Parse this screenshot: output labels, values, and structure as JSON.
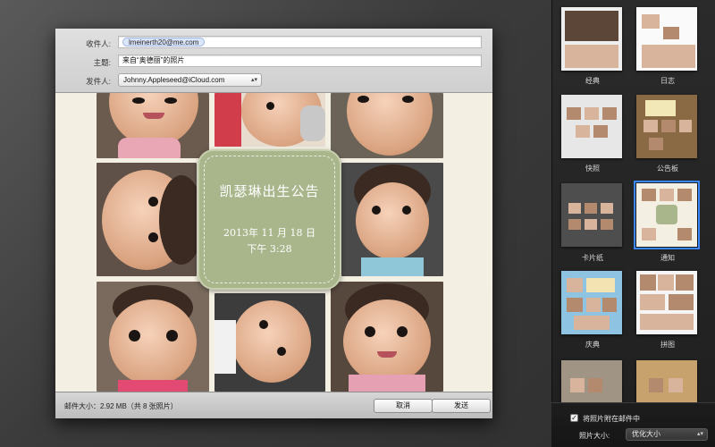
{
  "compose": {
    "to_label": "收件人:",
    "to_value": "lmeinerth20@me.com",
    "subject_label": "主题:",
    "subject_value": "来自“奥德丽”的照片",
    "from_label": "发件人:",
    "from_value": "Johnny.Appleseed@iCloud.com"
  },
  "card": {
    "title": "凯瑟琳出生公告",
    "date": "2013年 11 月 18 日",
    "time": "下午 3:28"
  },
  "footer": {
    "size_text": "邮件大小：2.92 MB（共 8 张照片）",
    "cancel_label": "取消",
    "send_label": "发送"
  },
  "templates": [
    {
      "label": "经典"
    },
    {
      "label": "日志"
    },
    {
      "label": "快照"
    },
    {
      "label": "公告板"
    },
    {
      "label": "卡片纸"
    },
    {
      "label": "通知",
      "selected": true
    },
    {
      "label": "庆典"
    },
    {
      "label": "拼图"
    }
  ],
  "options": {
    "attach_label": "将照片附在邮件中",
    "attach_checked": true,
    "size_label": "照片大小:",
    "size_value": "优化大小"
  },
  "colors": {
    "selection": "#3a86ff",
    "card_bg": "#a9b68c"
  }
}
